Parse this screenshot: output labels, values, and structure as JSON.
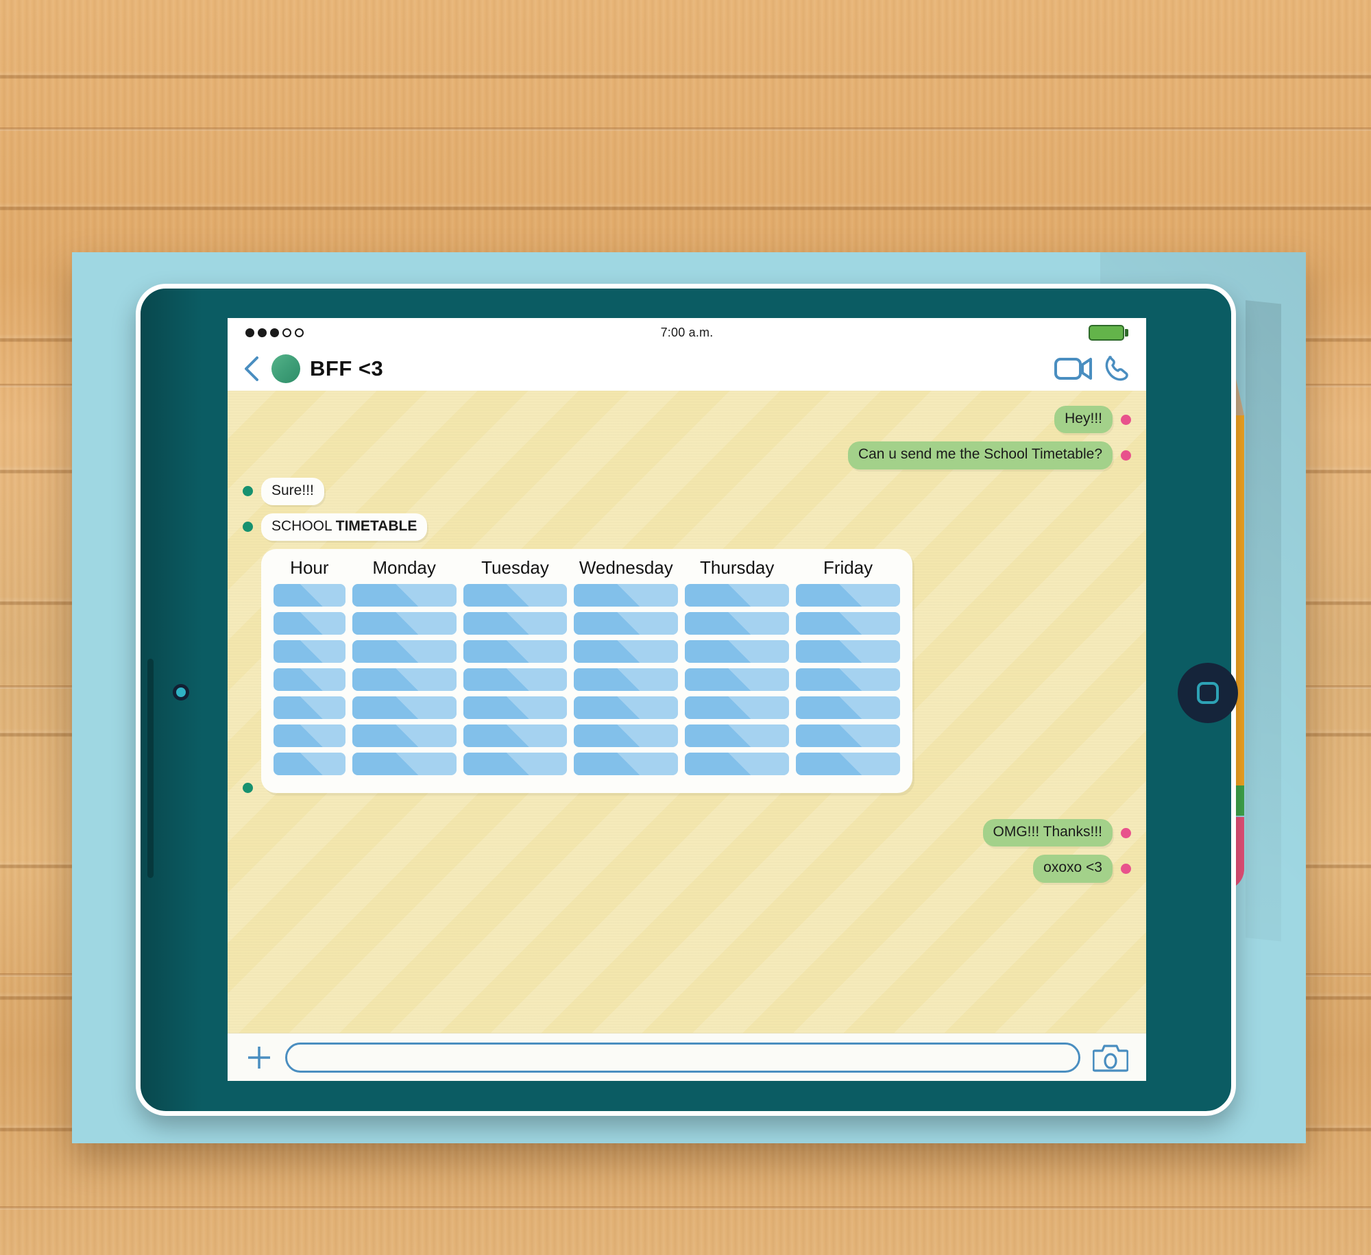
{
  "scene": {
    "surface": "wooden-desk",
    "mat_color": "#9fd7e2",
    "device": "tablet",
    "device_body_color": "#0b5c63",
    "accessory": "yellow-pencil"
  },
  "statusbar": {
    "signal_dots_filled": 3,
    "signal_dots_empty": 2,
    "time": "7:00 a.m.",
    "battery_level": "full",
    "battery_color": "#63b44a"
  },
  "header": {
    "back_icon": "chevron-left-icon",
    "avatar_color": "#3f9f78",
    "contact_name": "BFF <3",
    "video_call_icon": "video-camera-icon",
    "voice_call_icon": "phone-handset-icon",
    "icon_color": "#4a8ec0"
  },
  "chat": {
    "background_color": "#f3e6ad",
    "outgoing_bubble_color": "#a3d18a",
    "incoming_bubble_color": "#fdfdfa",
    "outgoing_dot_color": "#e8528c",
    "incoming_dot_color": "#17916f",
    "messages": [
      {
        "id": "m1",
        "side": "right",
        "style": "out",
        "text": "Hey!!!"
      },
      {
        "id": "m2",
        "side": "right",
        "style": "out",
        "text": "Can u send me the School Timetable?"
      },
      {
        "id": "m3",
        "side": "left",
        "style": "in",
        "text": "Sure!!!"
      },
      {
        "id": "m4",
        "side": "left",
        "style": "in",
        "text_plain": "SCHOOL ",
        "text_strong": "TIMETABLE"
      },
      {
        "id": "m5",
        "side": "left",
        "style": "attachment",
        "attachment": "school-timetable"
      },
      {
        "id": "m6",
        "side": "right",
        "style": "out",
        "text": "OMG!!! Thanks!!!"
      },
      {
        "id": "m7",
        "side": "right",
        "style": "out",
        "text": "oxoxo <3"
      }
    ]
  },
  "timetable": {
    "columns": [
      "Hour",
      "Monday",
      "Tuesday",
      "Wednesday",
      "Thursday",
      "Friday"
    ],
    "row_count": 7,
    "cell_color": "#82c0ea",
    "card_color": "#fdfdfa",
    "cells": [
      [
        "",
        "",
        "",
        "",
        "",
        ""
      ],
      [
        "",
        "",
        "",
        "",
        "",
        ""
      ],
      [
        "",
        "",
        "",
        "",
        "",
        ""
      ],
      [
        "",
        "",
        "",
        "",
        "",
        ""
      ],
      [
        "",
        "",
        "",
        "",
        "",
        ""
      ],
      [
        "",
        "",
        "",
        "",
        "",
        ""
      ],
      [
        "",
        "",
        "",
        "",
        "",
        ""
      ]
    ]
  },
  "inputbar": {
    "add_icon": "plus-icon",
    "input_value": "",
    "input_placeholder": "",
    "camera_icon": "camera-icon",
    "accent_color": "#4a8ec0"
  },
  "pencil": {
    "tip_color": "#1a1a1a",
    "wood_color": "#dcc3a0",
    "body_color": "#f7e04a",
    "body_shade_color": "#f5a623",
    "ferrule_color": "#5cb85c",
    "eraser_color": "#f2827f"
  }
}
